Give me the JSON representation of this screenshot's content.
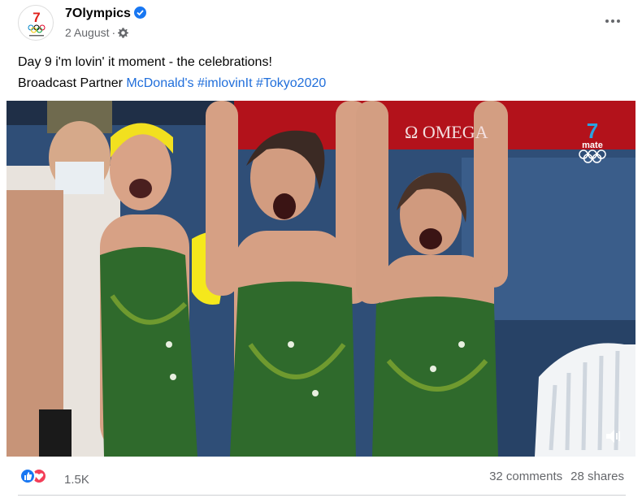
{
  "header": {
    "page_name": "7Olympics",
    "date": "2 August",
    "separator": "·",
    "verified_icon": "verified-badge-icon",
    "audience_icon": "gear-icon",
    "more_icon": "more-horizontal-icon"
  },
  "post": {
    "line1": "Day 9 i'm lovin' it moment - the celebrations!",
    "line2_prefix": "Broadcast Partner ",
    "links": [
      "McDonald's",
      "#imlovinIt",
      "#Tokyo2020"
    ]
  },
  "media": {
    "banner_text": "Ω OMEGA",
    "channel_number": "7",
    "channel_name": "mate",
    "mute_icon": "speaker-icon"
  },
  "footer": {
    "reaction_count": "1.5K",
    "comments": "32 comments",
    "shares": "28 shares"
  },
  "colors": {
    "link": "#216fdb",
    "like": "#1877f2",
    "love": "#f33e58",
    "swimsuit": "#2f6a2c"
  }
}
